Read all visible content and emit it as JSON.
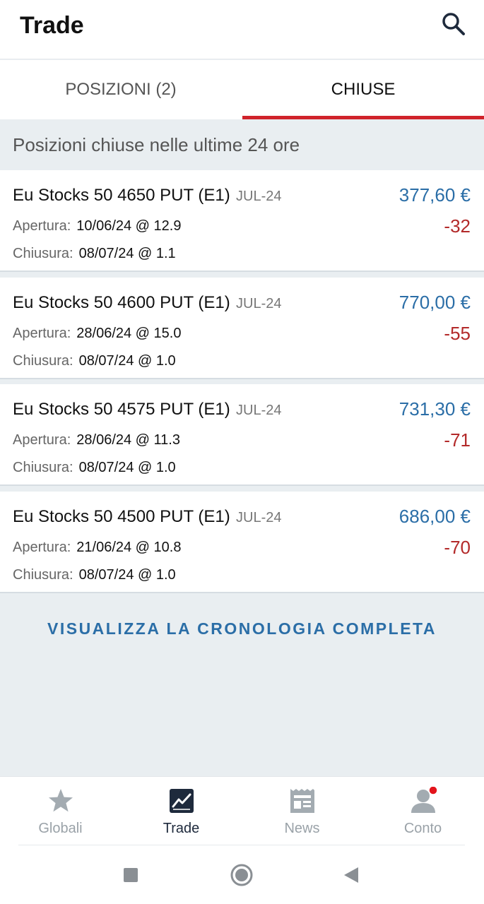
{
  "header": {
    "title": "Trade",
    "search_icon": "search-icon"
  },
  "tabs": [
    {
      "label": "POSIZIONI (2)",
      "active": false
    },
    {
      "label": "CHIUSE",
      "active": true
    }
  ],
  "section": {
    "title": "Posizioni chiuse nelle ultime 24 ore"
  },
  "labels": {
    "open": "Apertura:",
    "close": "Chiusura:"
  },
  "positions": [
    {
      "name": "Eu Stocks 50 4650 PUT (E1)",
      "expiry": "JUL-24",
      "open": "10/06/24 @ 12.9",
      "close": "08/07/24 @ 1.1",
      "amount": "377,60 €",
      "pl": "-32"
    },
    {
      "name": "Eu Stocks 50 4600 PUT (E1)",
      "expiry": "JUL-24",
      "open": "28/06/24 @ 15.0",
      "close": "08/07/24 @ 1.0",
      "amount": "770,00 €",
      "pl": "-55"
    },
    {
      "name": "Eu Stocks 50 4575 PUT (E1)",
      "expiry": "JUL-24",
      "open": "28/06/24 @ 11.3",
      "close": "08/07/24 @ 1.0",
      "amount": "731,30 €",
      "pl": "-71"
    },
    {
      "name": "Eu Stocks 50 4500 PUT (E1)",
      "expiry": "JUL-24",
      "open": "21/06/24 @ 10.8",
      "close": "08/07/24 @ 1.0",
      "amount": "686,00 €",
      "pl": "-70"
    }
  ],
  "history_link": "VISUALIZZA LA CRONOLOGIA COMPLETA",
  "bottom_nav": [
    {
      "label": "Globali",
      "icon": "star-icon",
      "active": false
    },
    {
      "label": "Trade",
      "icon": "chart-icon",
      "active": true
    },
    {
      "label": "News",
      "icon": "newspaper-icon",
      "active": false
    },
    {
      "label": "Conto",
      "icon": "user-icon",
      "active": false,
      "badge": true
    }
  ],
  "colors": {
    "accent_blue": "#2b6ea7",
    "loss_red": "#b32a2a",
    "tab_underline": "#d0232b",
    "badge_red": "#e3141c",
    "nav_active": "#1e2a3c"
  }
}
